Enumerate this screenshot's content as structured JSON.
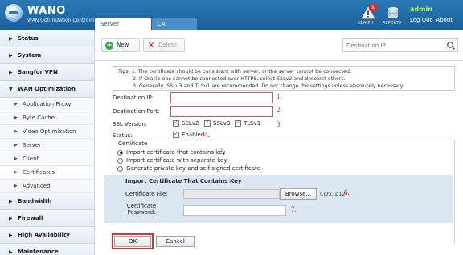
{
  "header": {
    "brand": "WANO",
    "brand_sub": "WAN Optimization Controller",
    "tabs": [
      {
        "label": "Server Certificate",
        "active": true
      },
      {
        "label": "CA Certificate",
        "active": false
      }
    ],
    "health_label": "HEALTH",
    "health_badge": "1",
    "reports_label": "REPORTS",
    "user": "admin",
    "logout": "Log Out",
    "about": "About",
    "colors": {
      "header_blue": "#2a79b6",
      "user_green": "#b6f24a",
      "alert_red": "#e22222"
    }
  },
  "sidebar": {
    "items": [
      {
        "label": "Status",
        "type": "section"
      },
      {
        "label": "System",
        "type": "section"
      },
      {
        "label": "Sangfor VPN",
        "type": "section"
      },
      {
        "label": "WAN Optimization",
        "type": "section",
        "expanded": true
      },
      {
        "label": "Application Proxy",
        "type": "sub"
      },
      {
        "label": "Byte Cache",
        "type": "sub"
      },
      {
        "label": "Video Optimization",
        "type": "sub"
      },
      {
        "label": "Server",
        "type": "sub"
      },
      {
        "label": "Client",
        "type": "sub"
      },
      {
        "label": "Certificates",
        "type": "sub",
        "active": true
      },
      {
        "label": "Advanced",
        "type": "sub"
      },
      {
        "label": "Bandwidth Management",
        "type": "section"
      },
      {
        "label": "Firewall",
        "type": "section"
      },
      {
        "label": "High Availability",
        "type": "section"
      },
      {
        "label": "Maintenance",
        "type": "section"
      }
    ]
  },
  "toolbar": {
    "new_label": "New",
    "delete_label": "Delete",
    "search_placeholder": "Destination IP",
    "icons": {
      "new": "plus-circle-icon",
      "delete": "x-icon",
      "search": "search-icon"
    }
  },
  "tips": {
    "line1": "Tips: 1. The certificate should be consistent with server, or the server cannot be connected.",
    "line2": "2. If Oracle ebs cannot be connected over HTTPS, select SSLv2 and deselect others.",
    "line3": "3. Generally, SSLv3 and TLSv1 are recommended. Do not change the settings unless absolutely necessary."
  },
  "form": {
    "dest_ip_label": "Destination IP:",
    "dest_ip_value": "",
    "dest_port_label": "Destination Port:",
    "dest_port_value": "",
    "ssl_label": "SSL Version:",
    "ssl_options": [
      {
        "label": "SSLv2",
        "checked": true
      },
      {
        "label": "SSLv3",
        "checked": true
      },
      {
        "label": "TLSv1",
        "checked": true
      }
    ],
    "status_label": "Status:",
    "enabled_label": "Enabled",
    "enabled_checked": true,
    "certificate_legend": "Certificate",
    "cert_options": [
      {
        "label": "Import certificate that contains key",
        "selected": true
      },
      {
        "label": "Import certificate with separate key",
        "selected": false
      },
      {
        "label": "Generate private key and self-signed certificate",
        "selected": false
      }
    ],
    "import_title": "Import Certificate That Contains Key",
    "cert_file_label": "Certificate File:",
    "browse_label": "Browse...",
    "ext_hint": "(.pfx,.p12)",
    "cert_pw_label1": "Certificate",
    "cert_pw_label2": "Password:",
    "ok_label": "OK",
    "cancel_label": "Cancel"
  },
  "annotations": {
    "n1": "1.",
    "n2": "2.",
    "n3": "3.",
    "n4": "4.",
    "n5": "5.",
    "n6": "6.",
    "n7": "7.",
    "color": "#e0302a"
  }
}
